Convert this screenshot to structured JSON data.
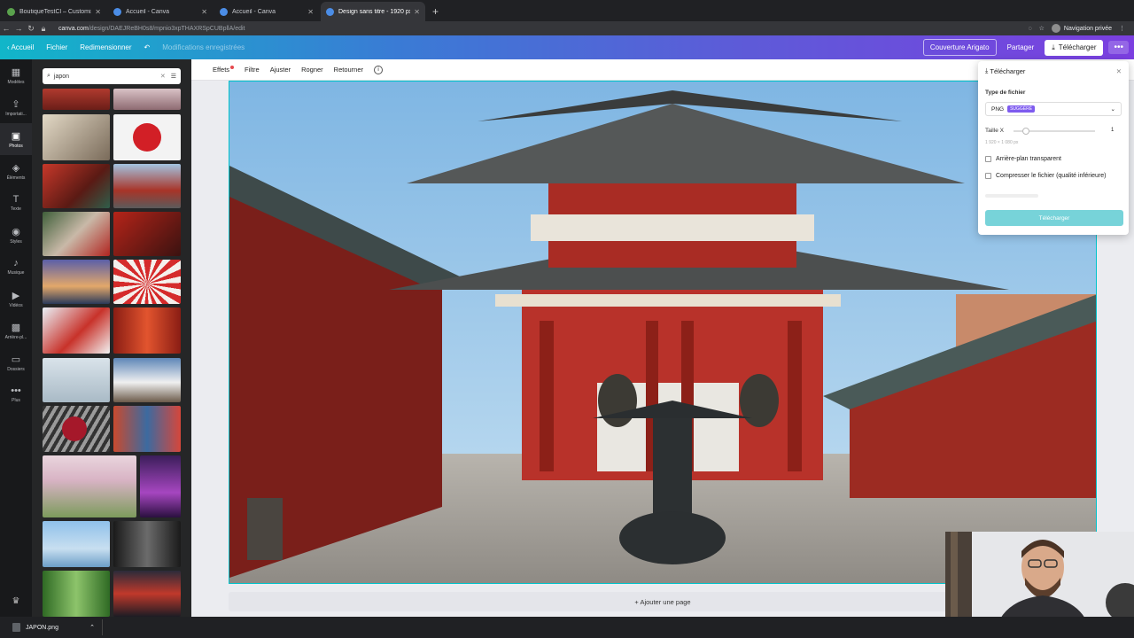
{
  "browser": {
    "tabs": [
      {
        "title": "BoutiqueTestCl – Customize -",
        "active": false
      },
      {
        "title": "Accueil - Canva",
        "active": false
      },
      {
        "title": "Accueil - Canva",
        "active": false
      },
      {
        "title": "Design sans titre - 1920 px × 1",
        "active": true
      }
    ],
    "url_host": "canva.com",
    "url_path": "/design/DAEJReBH0s8/mpnio3xpTHAXRSpCUBpllA/edit",
    "private_label": "Navigation privée"
  },
  "header": {
    "home": "Accueil",
    "file": "Fichier",
    "resize": "Redimensionner",
    "saved_status": "Modifications enregistrées",
    "cover": "Couverture Arigato",
    "share": "Partager",
    "download": "Télécharger"
  },
  "rail": {
    "items": [
      {
        "label": "Modèles",
        "icon": "▦"
      },
      {
        "label": "Importati...",
        "icon": "⇪"
      },
      {
        "label": "Photos",
        "icon": "▣"
      },
      {
        "label": "Éléments",
        "icon": "◈"
      },
      {
        "label": "Texte",
        "icon": "T"
      },
      {
        "label": "Styles",
        "icon": "◉"
      },
      {
        "label": "Musique",
        "icon": "♪"
      },
      {
        "label": "Vidéos",
        "icon": "▶"
      },
      {
        "label": "Arrière-pl...",
        "icon": "▩"
      },
      {
        "label": "Dossiers",
        "icon": "▭"
      },
      {
        "label": "Plus",
        "icon": "•••"
      }
    ]
  },
  "panel": {
    "search_value": "japon"
  },
  "toolbar": {
    "effects": "Effets",
    "filter": "Filtre",
    "adjust": "Ajuster",
    "crop": "Rogner",
    "flip": "Retourner"
  },
  "download_panel": {
    "title": "Télécharger",
    "file_type_label": "Type de fichier",
    "file_type": "PNG",
    "badge": "SUGGÉRÉ",
    "size_label": "Taille X",
    "size_value": "1",
    "size_dims": "1 920 × 1 080 px",
    "transparent_bg": "Arrière-plan transparent",
    "compress": "Compresser le fichier (qualité inférieure)",
    "button": "Télécharger"
  },
  "canvas": {
    "add_page": "+ Ajouter une page"
  },
  "downloads_bar": {
    "file": "JAPON.png"
  },
  "colors": {
    "accent_teal": "#00c4cc",
    "header_gradient_start": "#11b6c9",
    "header_gradient_end": "#7b3fe0",
    "temple_red": "#b8322a"
  }
}
